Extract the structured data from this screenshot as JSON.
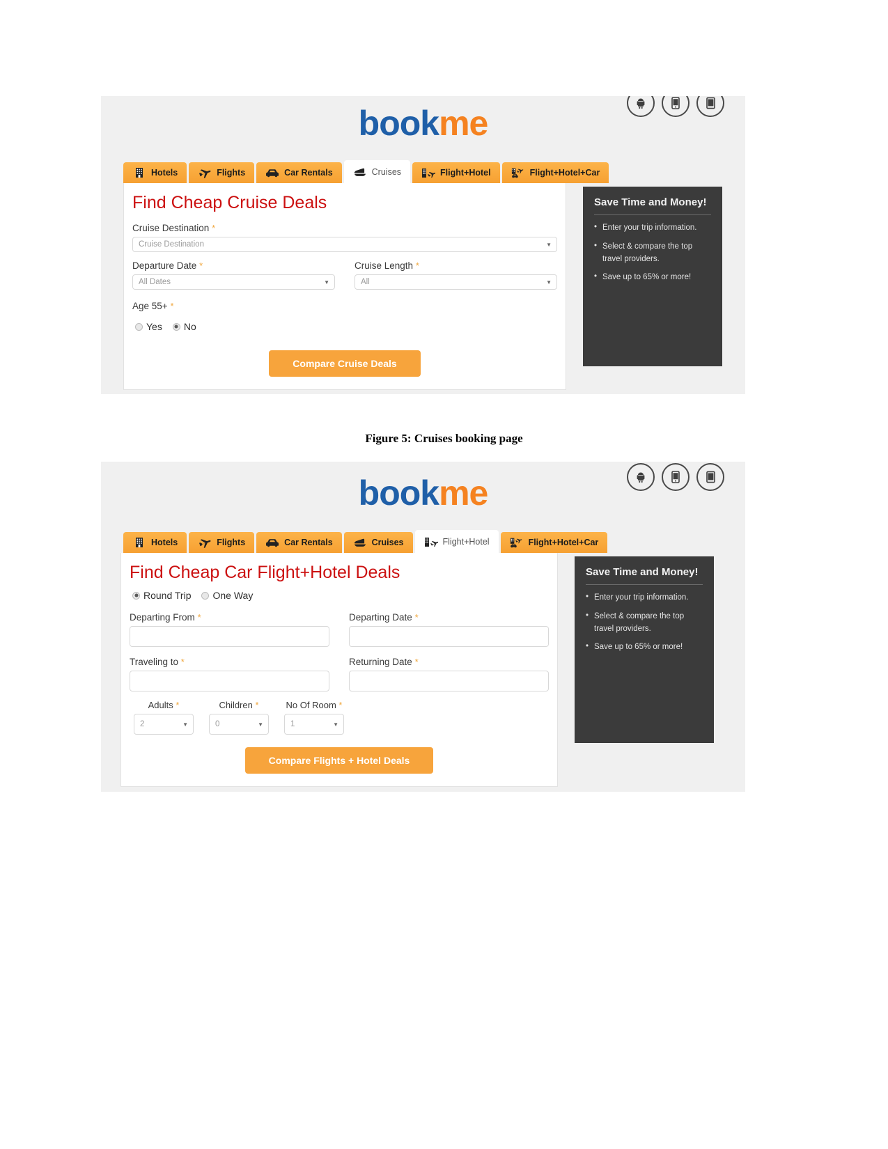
{
  "caption": "Figure 5: Cruises booking page",
  "brand": {
    "part1": "book",
    "part2": "me"
  },
  "app_icons": [
    {
      "name": "android-app-icon"
    },
    {
      "name": "mobile-app-icon"
    },
    {
      "name": "tablet-app-icon"
    }
  ],
  "tabs": [
    {
      "label": "Hotels",
      "icon": "hotel-building-icon"
    },
    {
      "label": "Flights",
      "icon": "airplane-icon"
    },
    {
      "label": "Car Rentals",
      "icon": "car-icon"
    },
    {
      "label": "Cruises",
      "icon": "cruise-ship-icon"
    },
    {
      "label": "Flight+Hotel",
      "icon": "flight-hotel-icon"
    },
    {
      "label": "Flight+Hotel+Car",
      "icon": "flight-hotel-car-icon"
    }
  ],
  "aside": {
    "title": "Save Time and Money!",
    "bullets": [
      "Enter your trip information.",
      "Select & compare the top travel providers.",
      "Save up to 65% or more!"
    ]
  },
  "cruise_form": {
    "active_tab": "Cruises",
    "title": "Find Cheap Cruise Deals",
    "destination": {
      "label": "Cruise Destination",
      "required": "*",
      "placeholder": "Cruise Destination",
      "value": ""
    },
    "departure_date": {
      "label": "Departure Date",
      "required": "*",
      "value": "All Dates"
    },
    "cruise_length": {
      "label": "Cruise Length",
      "required": "*",
      "value": "All"
    },
    "age": {
      "label": "Age 55+",
      "required": "*",
      "options": [
        {
          "label": "Yes",
          "selected": false
        },
        {
          "label": "No",
          "selected": true
        }
      ]
    },
    "submit_label": "Compare Cruise Deals"
  },
  "flighthotel_form": {
    "active_tab": "Flight+Hotel",
    "title": "Find Cheap Car Flight+Hotel Deals",
    "trip_type": [
      {
        "label": "Round Trip",
        "selected": true
      },
      {
        "label": "One Way",
        "selected": false
      }
    ],
    "departing_from": {
      "label": "Departing From",
      "required": "*",
      "value": ""
    },
    "departing_date": {
      "label": "Departing Date",
      "required": "*",
      "value": ""
    },
    "traveling_to": {
      "label": "Traveling to",
      "required": "*",
      "value": ""
    },
    "returning_date": {
      "label": "Returning Date",
      "required": "*",
      "value": ""
    },
    "adults": {
      "label": "Adults",
      "required": "*",
      "value": "2"
    },
    "children": {
      "label": "Children",
      "required": "*",
      "value": "0"
    },
    "rooms": {
      "label": "No Of Room",
      "required": "*",
      "value": "1"
    },
    "submit_label": "Compare Flights + Hotel Deals"
  },
  "colors": {
    "brand_blue": "#1f5fa8",
    "brand_orange": "#f58220",
    "tab_orange": "#f9a93c",
    "title_red": "#cc1111",
    "aside_bg": "#3b3b3b",
    "button_orange": "#f7a43c"
  }
}
